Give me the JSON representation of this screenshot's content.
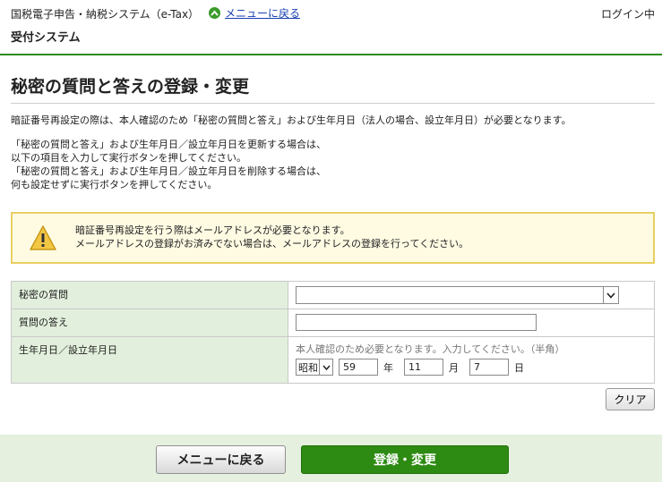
{
  "header": {
    "system_name": "国税電子申告・納税システム（e-Tax）",
    "menu_link": "メニューに戻る",
    "login_state": "ログイン中",
    "subsystem": "受付システム"
  },
  "page": {
    "title": "秘密の質問と答えの登録・変更",
    "intro": "暗証番号再設定の際は、本人確認のため「秘密の質問と答え」および生年月日（法人の場合、設立年月日）が必要となります。",
    "instructions": [
      "「秘密の質問と答え」および生年月日／設立年月日を更新する場合は、",
      "以下の項目を入力して実行ボタンを押してください。",
      "「秘密の質問と答え」および生年月日／設立年月日を削除する場合は、",
      "何も設定せずに実行ボタンを押してください。"
    ]
  },
  "notice": {
    "icon": "warning-icon",
    "lines": [
      "暗証番号再設定を行う際はメールアドレスが必要となります。",
      "メールアドレスの登録がお済みでない場合は、メールアドレスの登録を行ってください。"
    ],
    "border_color": "#e8cf63",
    "background": "#fffbe3"
  },
  "form": {
    "question_label": "秘密の質問",
    "question_value": "",
    "answer_label": "質問の答え",
    "answer_value": "",
    "birthdate_label": "生年月日／設立年月日",
    "birthdate_hint": "本人確認のため必要となります。入力してください。（半角）",
    "era": "昭和",
    "year": "59",
    "year_unit": "年",
    "month": "11",
    "month_unit": "月",
    "day": "7",
    "day_unit": "日",
    "label_bg": "#e2efdc"
  },
  "buttons": {
    "clear": "クリア",
    "back": "メニューに戻る",
    "submit": "登録・変更",
    "submit_color": "#2d8a12"
  },
  "colors": {
    "accent_rule": "#2e8b1e",
    "footer_bg": "#e5f0df",
    "link": "#1a3fb3"
  }
}
